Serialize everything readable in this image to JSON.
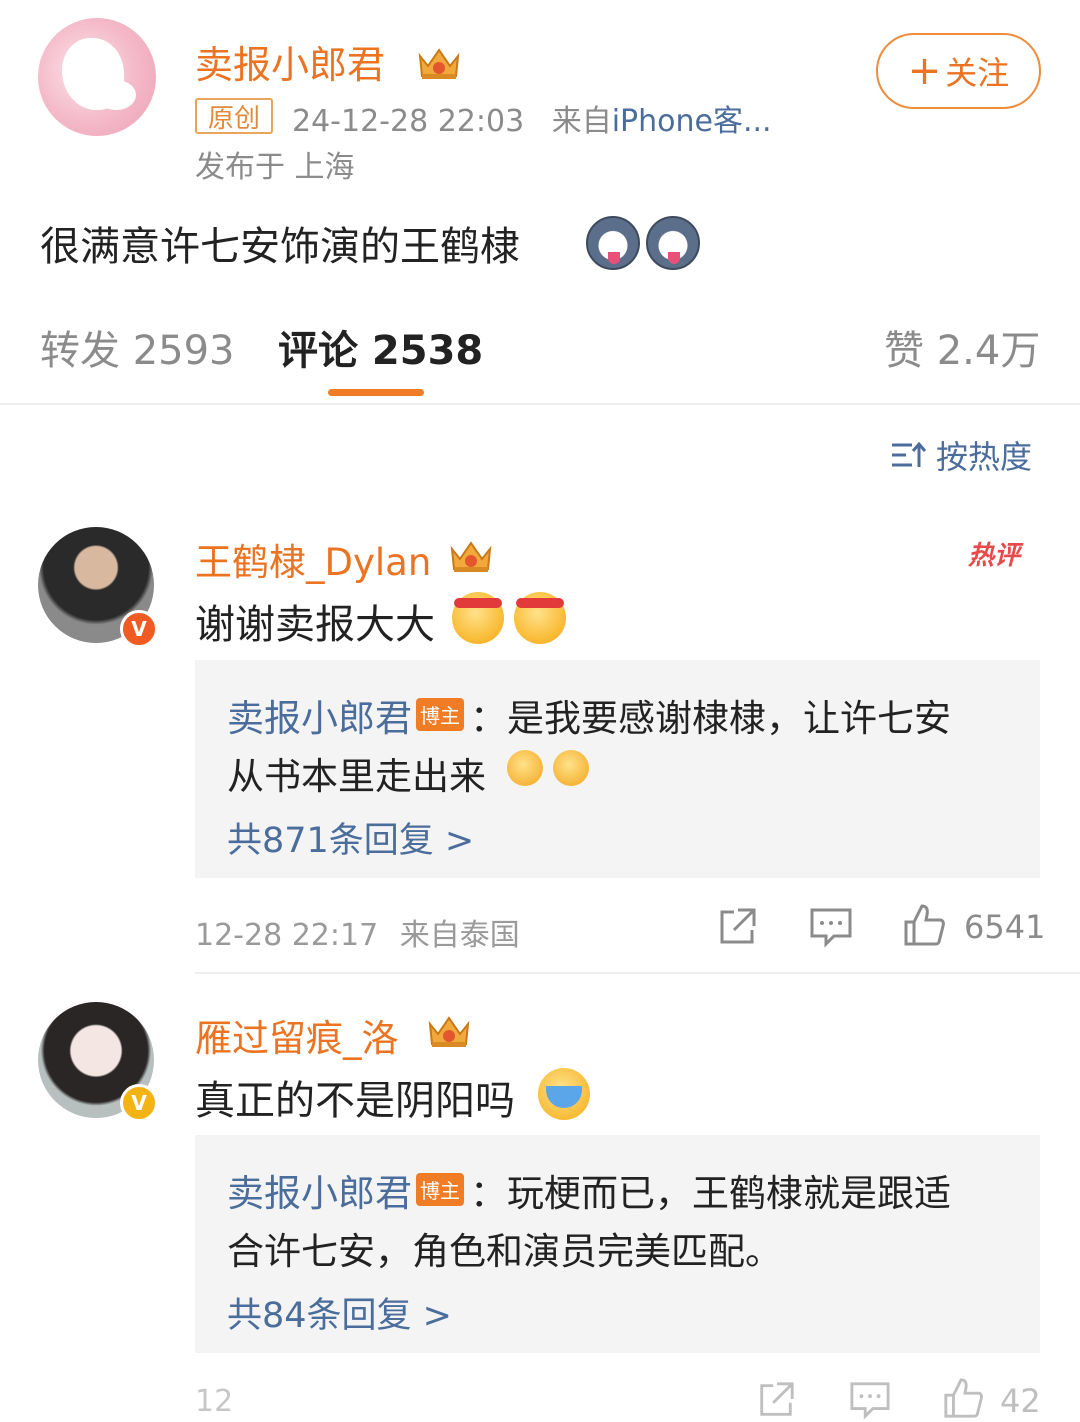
{
  "post": {
    "author": "卖报小郎君",
    "follow_label": "关注",
    "original_badge": "原创",
    "datetime": "24-12-28 22:03",
    "source_prefix": "来自",
    "source": "iPhone客...",
    "location": "发布于 上海",
    "text": "很满意许七安饰演的王鹤棣"
  },
  "tabs": [
    {
      "label": "转发 2593"
    },
    {
      "label": "评论 2538"
    },
    {
      "label": "赞 2.4万"
    }
  ],
  "sort_label": "按热度",
  "comments": [
    {
      "author": "王鹤棣_Dylan",
      "badge": "V",
      "hot_tag": "热评",
      "text": "谢谢卖报大大",
      "reply": {
        "author": "卖报小郎君",
        "author_tag": "博主",
        "line1": "：是我要感谢棣棣，让许七安",
        "line2": "从书本里走出来",
        "count_label": "共871条回复 >"
      },
      "time": "12-28 22:17",
      "location": "来自泰国",
      "likes": "6541"
    },
    {
      "author": "雁过留痕_洛",
      "badge": "V",
      "text": "真正的不是阴阳吗",
      "reply": {
        "author": "卖报小郎君",
        "author_tag": "博主",
        "line1": "：玩梗而已，王鹤棣就是跟适",
        "line2": "合许七安，角色和演员完美匹配。",
        "count_label": "共84条回复 >"
      },
      "time": "12",
      "likes": "42"
    }
  ],
  "colors": {
    "accent": "#f07c26",
    "name": "#eb7321",
    "link": "#4b6d9c"
  }
}
